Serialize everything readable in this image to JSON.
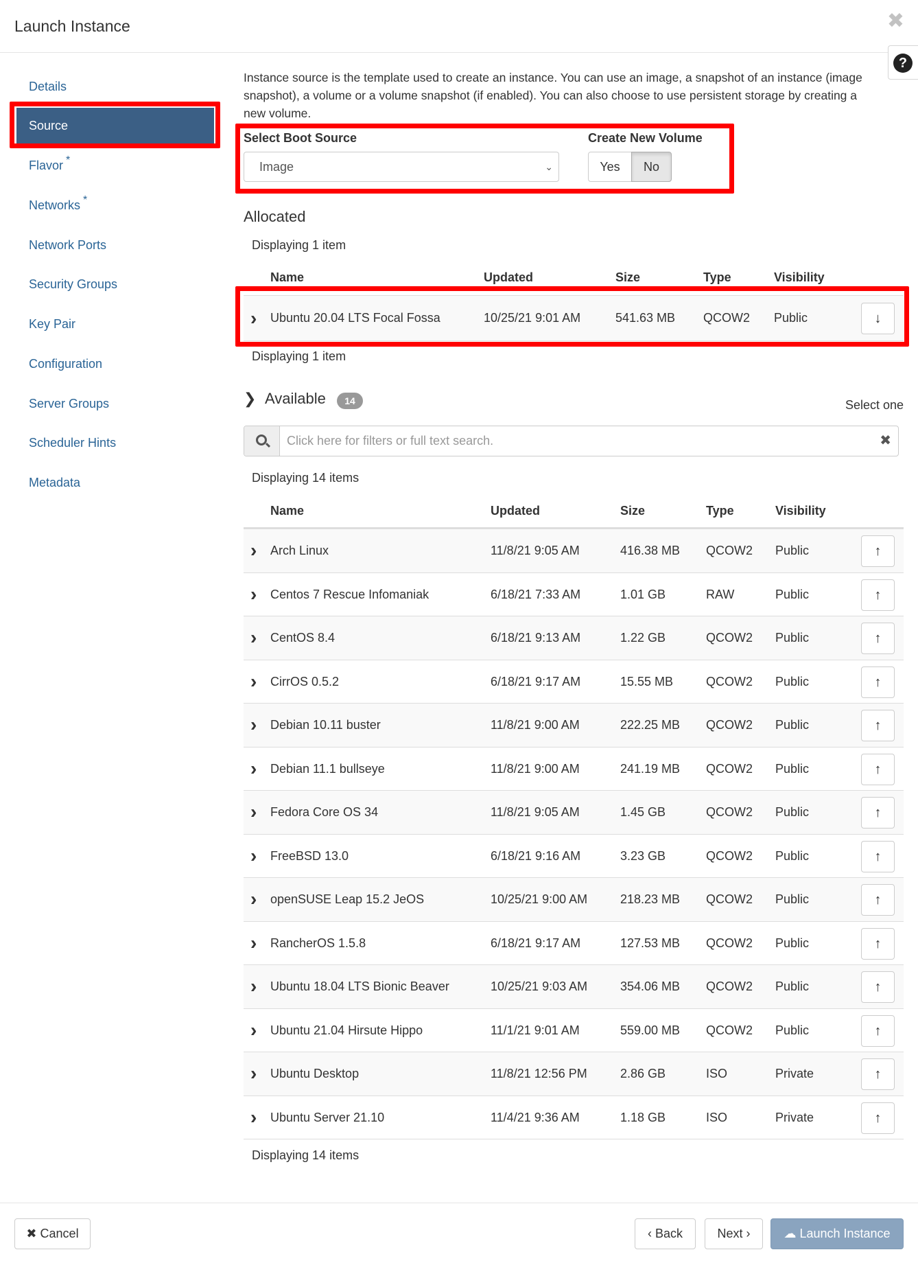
{
  "modal": {
    "title": "Launch Instance",
    "close_glyph": "✖",
    "help_glyph": "?"
  },
  "sidebar": {
    "items": [
      {
        "label": "Details",
        "required": false,
        "active": false
      },
      {
        "label": "Source",
        "required": false,
        "active": true
      },
      {
        "label": "Flavor",
        "required": true,
        "active": false
      },
      {
        "label": "Networks",
        "required": true,
        "active": false
      },
      {
        "label": "Network Ports",
        "required": false,
        "active": false
      },
      {
        "label": "Security Groups",
        "required": false,
        "active": false
      },
      {
        "label": "Key Pair",
        "required": false,
        "active": false
      },
      {
        "label": "Configuration",
        "required": false,
        "active": false
      },
      {
        "label": "Server Groups",
        "required": false,
        "active": false
      },
      {
        "label": "Scheduler Hints",
        "required": false,
        "active": false
      },
      {
        "label": "Metadata",
        "required": false,
        "active": false
      }
    ],
    "required_marker": "*"
  },
  "source": {
    "intro": "Instance source is the template used to create an instance. You can use an image, a snapshot of an instance (image snapshot), a volume or a volume snapshot (if enabled). You can also choose to use persistent storage by creating a new volume.",
    "boot_source_label": "Select Boot Source",
    "boot_source_value": "Image",
    "create_volume_label": "Create New Volume",
    "yes_label": "Yes",
    "no_label": "No",
    "create_volume_selected": "No"
  },
  "allocated": {
    "title": "Allocated",
    "display_count": "Displaying 1 item",
    "columns": [
      "Name",
      "Updated",
      "Size",
      "Type",
      "Visibility"
    ],
    "rows": [
      {
        "name": "Ubuntu 20.04 LTS Focal Fossa",
        "updated": "10/25/21 9:01 AM",
        "size": "541.63 MB",
        "type": "QCOW2",
        "visibility": "Public"
      }
    ],
    "action_icon": "arrow-down-icon"
  },
  "available": {
    "title": "Available",
    "count_badge": "14",
    "select_hint": "Select one",
    "search_placeholder": "Click here for filters or full text search.",
    "display_count": "Displaying 14 items",
    "columns": [
      "Name",
      "Updated",
      "Size",
      "Type",
      "Visibility"
    ],
    "rows": [
      {
        "name": "Arch Linux",
        "updated": "11/8/21 9:05 AM",
        "size": "416.38 MB",
        "type": "QCOW2",
        "visibility": "Public"
      },
      {
        "name": "Centos 7 Rescue Infomaniak",
        "updated": "6/18/21 7:33 AM",
        "size": "1.01 GB",
        "type": "RAW",
        "visibility": "Public"
      },
      {
        "name": "CentOS 8.4",
        "updated": "6/18/21 9:13 AM",
        "size": "1.22 GB",
        "type": "QCOW2",
        "visibility": "Public"
      },
      {
        "name": "CirrOS 0.5.2",
        "updated": "6/18/21 9:17 AM",
        "size": "15.55 MB",
        "type": "QCOW2",
        "visibility": "Public"
      },
      {
        "name": "Debian 10.11 buster",
        "updated": "11/8/21 9:00 AM",
        "size": "222.25 MB",
        "type": "QCOW2",
        "visibility": "Public"
      },
      {
        "name": "Debian 11.1 bullseye",
        "updated": "11/8/21 9:00 AM",
        "size": "241.19 MB",
        "type": "QCOW2",
        "visibility": "Public"
      },
      {
        "name": "Fedora Core OS 34",
        "updated": "11/8/21 9:05 AM",
        "size": "1.45 GB",
        "type": "QCOW2",
        "visibility": "Public"
      },
      {
        "name": "FreeBSD 13.0",
        "updated": "6/18/21 9:16 AM",
        "size": "3.23 GB",
        "type": "QCOW2",
        "visibility": "Public"
      },
      {
        "name": "openSUSE Leap 15.2 JeOS",
        "updated": "10/25/21 9:00 AM",
        "size": "218.23 MB",
        "type": "QCOW2",
        "visibility": "Public"
      },
      {
        "name": "RancherOS 1.5.8",
        "updated": "6/18/21 9:17 AM",
        "size": "127.53 MB",
        "type": "QCOW2",
        "visibility": "Public"
      },
      {
        "name": "Ubuntu 18.04 LTS Bionic Beaver",
        "updated": "10/25/21 9:03 AM",
        "size": "354.06 MB",
        "type": "QCOW2",
        "visibility": "Public"
      },
      {
        "name": "Ubuntu 21.04 Hirsute Hippo",
        "updated": "11/1/21 9:01 AM",
        "size": "559.00 MB",
        "type": "QCOW2",
        "visibility": "Public"
      },
      {
        "name": "Ubuntu Desktop",
        "updated": "11/8/21 12:56 PM",
        "size": "2.86 GB",
        "type": "ISO",
        "visibility": "Private"
      },
      {
        "name": "Ubuntu Server 21.10",
        "updated": "11/4/21 9:36 AM",
        "size": "1.18 GB",
        "type": "ISO",
        "visibility": "Private"
      }
    ],
    "action_icon": "arrow-up-icon"
  },
  "footer": {
    "cancel_label": "Cancel",
    "back_label": "Back",
    "next_label": "Next",
    "launch_label": "Launch Instance"
  },
  "colors": {
    "active_nav": "#3b5f85",
    "link": "#2a6496",
    "highlight_outline": "#ff0000",
    "primary_button": "#8aa4bf",
    "badge": "#999999"
  }
}
